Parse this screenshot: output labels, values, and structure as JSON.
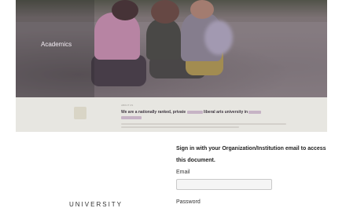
{
  "hero": {
    "label": "Academics"
  },
  "band": {
    "eyebrow": "ABOUT US",
    "headline_start": "We are a nationally ranked, private",
    "headline_mid": "liberal arts university in"
  },
  "signin": {
    "heading": "Sign in with your Organization/Institution email to access this document.",
    "email_label": "Email",
    "email_value": "",
    "password_label": "Password"
  },
  "brand": {
    "wordmark": "UNIVERSITY"
  },
  "colors": {
    "accent": "#5f465f",
    "band_bg": "#e7e6e1"
  }
}
